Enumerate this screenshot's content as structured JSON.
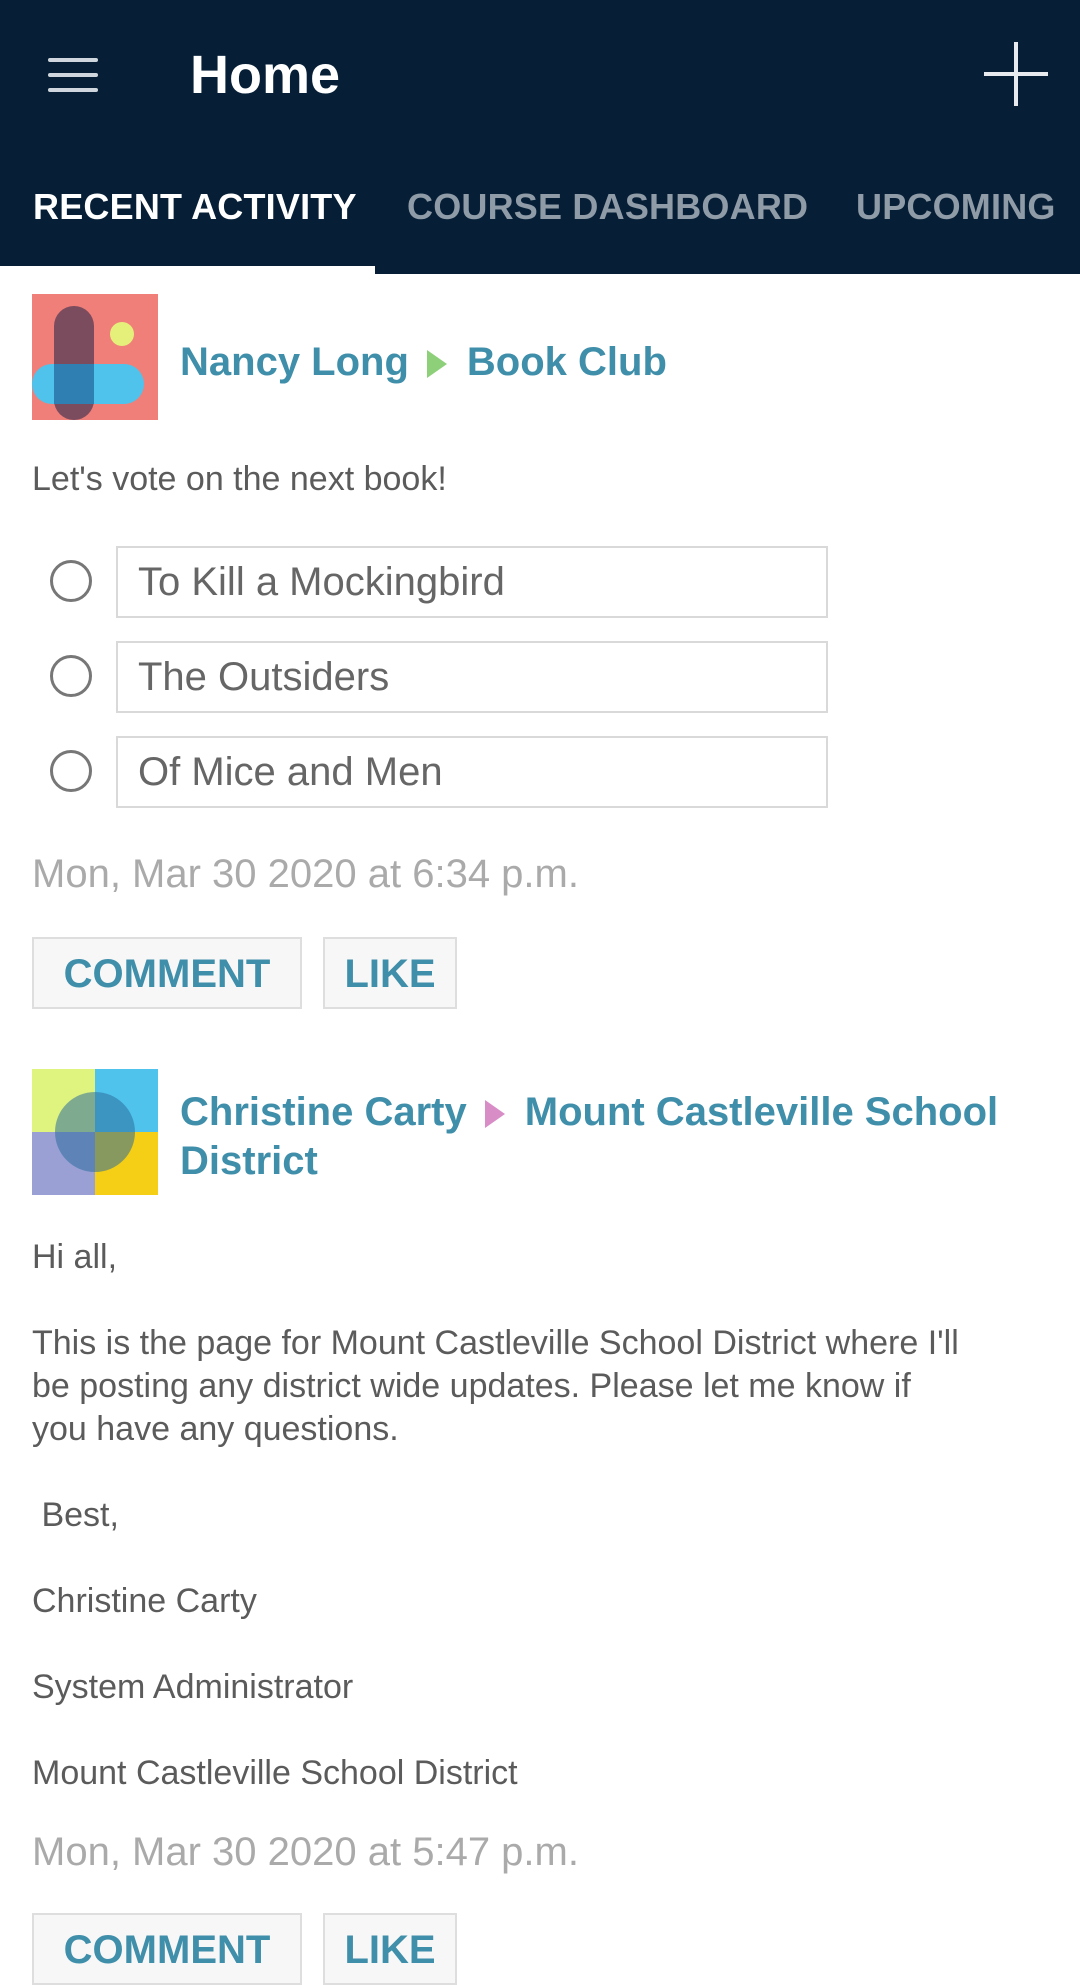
{
  "app_bar": {
    "title": "Home",
    "menu_icon": "hamburger-menu-icon",
    "add_icon": "plus-icon"
  },
  "tabs": [
    {
      "label": "RECENT ACTIVITY",
      "active": true
    },
    {
      "label": "COURSE DASHBOARD",
      "active": false
    },
    {
      "label": "UPCOMING",
      "active": false
    }
  ],
  "posts": [
    {
      "author": "Nancy Long",
      "target": "Book Club",
      "arrow_color": "#8ed07a",
      "body": "Let's vote on the next book!",
      "poll_options": [
        "To Kill a Mockingbird",
        "The Outsiders",
        "Of Mice and Men"
      ],
      "timestamp": "Mon, Mar 30 2020 at 6:34 p.m.",
      "comment_label": "COMMENT",
      "like_label": "LIKE"
    },
    {
      "author": "Christine Carty",
      "target": "Mount Castleville School",
      "target_line2": "District",
      "arrow_color": "#d88dc7",
      "body_lines": [
        "Hi all,",
        "This is the page for Mount Castleville School District where I'll",
        "be posting any district wide updates. Please let me know if",
        "you have any questions.",
        " Best,",
        "Christine Carty",
        "System Administrator",
        "Mount Castleville School District"
      ],
      "timestamp": "Mon, Mar 30 2020 at 5:47 p.m.",
      "comment_label": "COMMENT",
      "like_label": "LIKE"
    }
  ],
  "colors": {
    "app_bar": "#061f36",
    "link": "#3f8eaa",
    "timestamp": "#aaaaaa"
  }
}
